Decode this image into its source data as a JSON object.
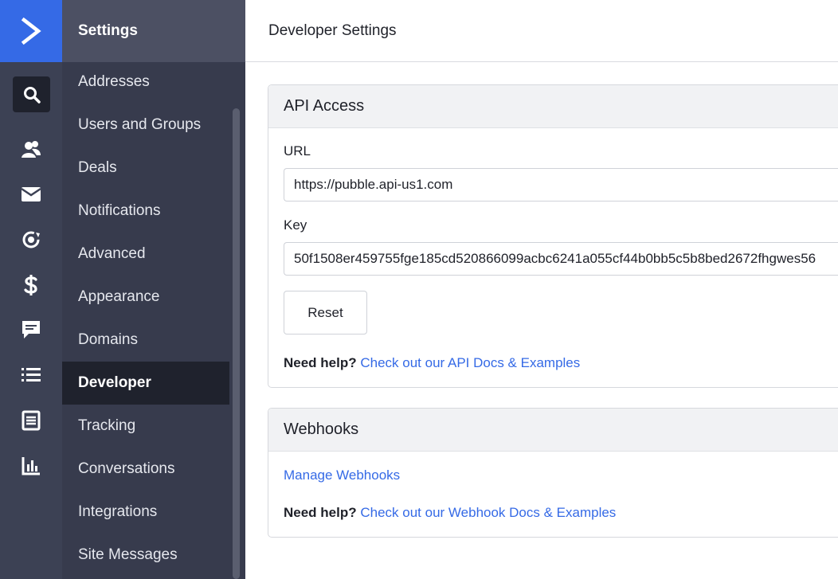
{
  "header": {
    "page_title": "Developer Settings"
  },
  "sidebar": {
    "title": "Settings",
    "items": [
      {
        "label": "Addresses"
      },
      {
        "label": "Users and Groups"
      },
      {
        "label": "Deals"
      },
      {
        "label": "Notifications"
      },
      {
        "label": "Advanced"
      },
      {
        "label": "Appearance"
      },
      {
        "label": "Domains"
      },
      {
        "label": "Developer",
        "active": true
      },
      {
        "label": "Tracking"
      },
      {
        "label": "Conversations"
      },
      {
        "label": "Integrations"
      },
      {
        "label": "Site Messages"
      }
    ]
  },
  "rail": {
    "icons": [
      "logo-chevron-icon",
      "search-icon",
      "contacts-icon",
      "email-icon",
      "automation-icon",
      "dollar-icon",
      "chat-icon",
      "lists-icon",
      "forms-icon",
      "reports-icon"
    ]
  },
  "api_access": {
    "title": "API Access",
    "url_label": "URL",
    "url_value": "https://pubble.api-us1.com",
    "key_label": "Key",
    "key_value": "50f1508er459755fge185cd520866099acbc6241a055cf44b0bb5c5b8bed2672fhgwes56",
    "reset_label": "Reset",
    "help_lead": "Need help?",
    "help_link": "Check out our API Docs & Examples"
  },
  "webhooks": {
    "title": "Webhooks",
    "manage_link": "Manage Webhooks",
    "help_lead": "Need help?",
    "help_link": "Check out our Webhook Docs & Examples"
  },
  "colors": {
    "brand": "#356ae6",
    "rail": "#3c4154",
    "sidebar": "#373b4d",
    "sidebar_active": "#1f222d",
    "link": "#356ae6"
  }
}
